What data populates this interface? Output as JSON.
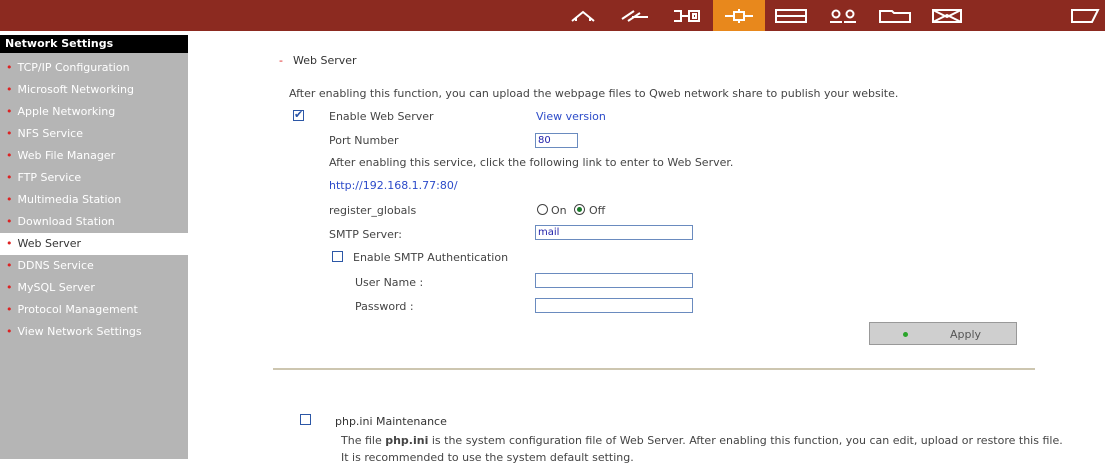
{
  "colors": {
    "topbar": "#8c2a20",
    "active_tab": "#e8881c",
    "sidebar": "#b5b5b5",
    "link": "#2c4bc9",
    "bullet": "#dd2222"
  },
  "topnav": {
    "icons": [
      "home-icon",
      "wizard-icon",
      "system-icon",
      "network-icon",
      "disk-icon",
      "users-icon",
      "folder-icon",
      "mail-icon",
      "tools-icon"
    ],
    "active": "network-icon"
  },
  "sidebar": {
    "title": "Network Settings",
    "items": [
      {
        "label": "TCP/IP Configuration"
      },
      {
        "label": "Microsoft Networking"
      },
      {
        "label": "Apple Networking"
      },
      {
        "label": "NFS Service"
      },
      {
        "label": "Web File Manager"
      },
      {
        "label": "FTP Service"
      },
      {
        "label": "Multimedia Station"
      },
      {
        "label": "Download Station"
      },
      {
        "label": "Web Server",
        "active": true
      },
      {
        "label": "DDNS Service"
      },
      {
        "label": "MySQL Server"
      },
      {
        "label": "Protocol Management"
      },
      {
        "label": "View Network Settings"
      }
    ]
  },
  "main": {
    "section_dash": "-",
    "section_title": "Web Server",
    "intro": "After enabling this function, you can upload the webpage files to Qweb network share to publish your website.",
    "enable_label": "Enable Web Server",
    "enable_checked": true,
    "view_version": "View version",
    "port_label": "Port Number",
    "port_value": "80",
    "link_note": "After enabling this service, click the following link to enter to Web Server.",
    "server_url": "http://192.168.1.77:80/",
    "register_globals_label": "register_globals",
    "on_label": "On",
    "off_label": "Off",
    "register_globals_value": "Off",
    "smtp_label": "SMTP Server:",
    "smtp_value": "mail",
    "smtp_auth_label": "Enable SMTP Authentication",
    "smtp_auth_checked": false,
    "username_label": "User Name :",
    "username_value": "",
    "password_label": "Password :",
    "password_value": "",
    "apply_label": "Apply",
    "php_label": "php.ini Maintenance",
    "php_checked": false,
    "php_desc_pre": "The file ",
    "php_desc_bold": "php.ini",
    "php_desc_post": " is the system configuration file of Web Server. After enabling this function, you can edit, upload or restore this file.",
    "php_desc2": "It is recommended to use the system default setting."
  }
}
